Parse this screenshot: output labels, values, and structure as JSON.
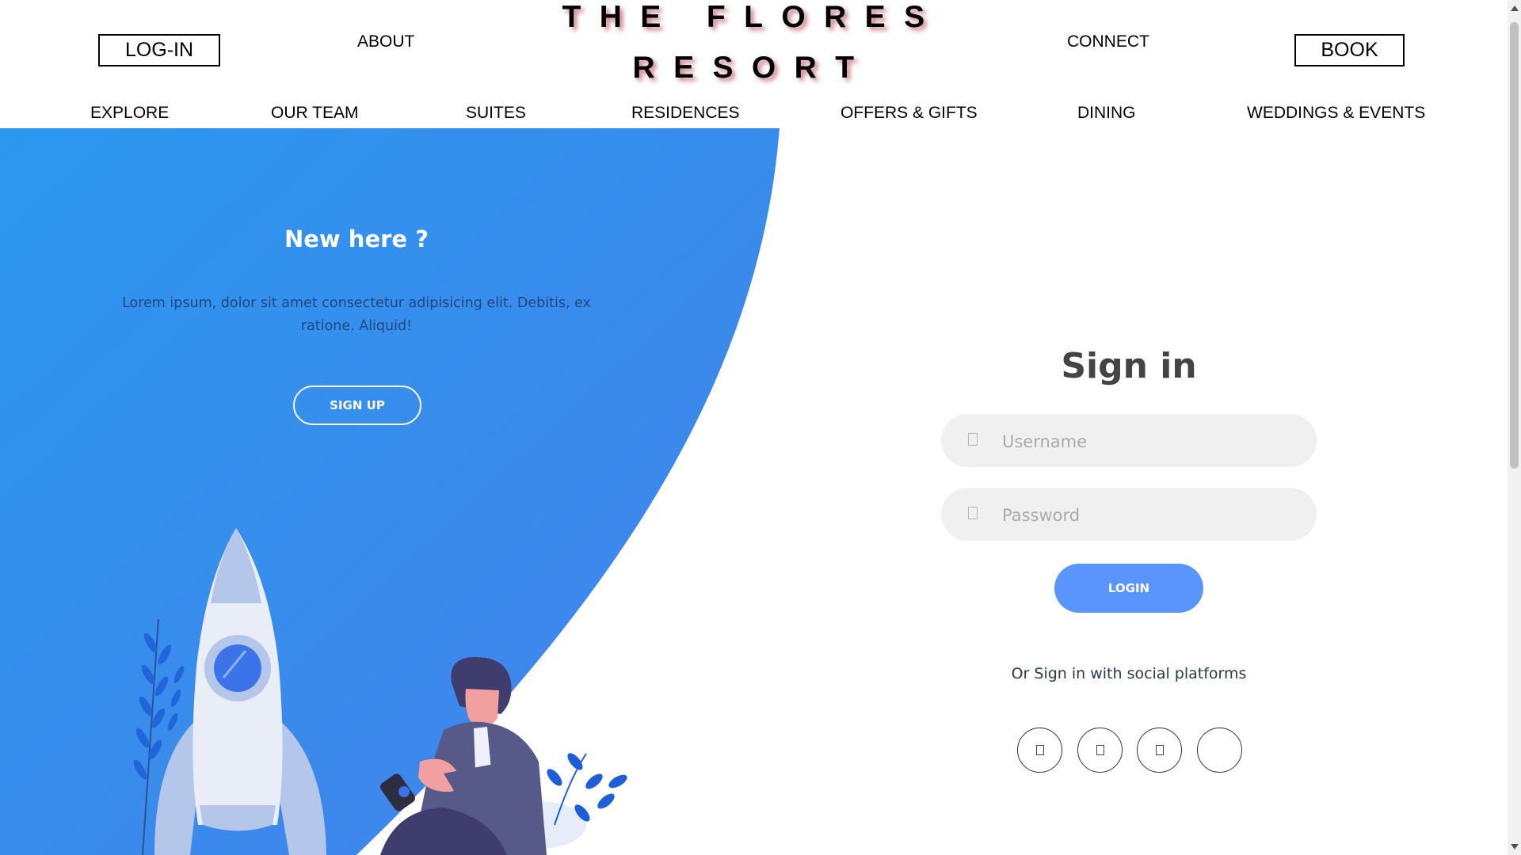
{
  "header": {
    "login_label": "LOG-IN",
    "about_label": "ABOUT",
    "brand_line1": "THE FLORES",
    "brand_line2": "RESORT",
    "connect_label": "CONNECT",
    "book_label": "BOOK"
  },
  "nav": {
    "items": [
      {
        "label": "EXPLORE"
      },
      {
        "label": "OUR TEAM"
      },
      {
        "label": "SUITES"
      },
      {
        "label": "RESIDENCES"
      },
      {
        "label": "OFFERS & GIFTS"
      },
      {
        "label": "DINING"
      },
      {
        "label": "WEDDINGS & EVENTS"
      }
    ]
  },
  "left_panel": {
    "heading": "New here ?",
    "text": "Lorem ipsum, dolor sit amet consectetur adipisicing elit. Debitis, ex ratione. Aliquid!",
    "signup_label": "SIGN UP"
  },
  "signin": {
    "title": "Sign in",
    "username_placeholder": "Username",
    "password_placeholder": "Password",
    "login_label": "LOGIN",
    "social_text": "Or Sign in with social platforms",
    "social_icons": [
      "facebook-icon",
      "twitter-icon",
      "google-icon",
      "linkedin-icon"
    ]
  },
  "colors": {
    "panel_blue_light": "#2f97ee",
    "panel_blue_dark": "#3d7ef0",
    "login_button": "#5995fd",
    "field_bg": "#f0f0f0"
  }
}
